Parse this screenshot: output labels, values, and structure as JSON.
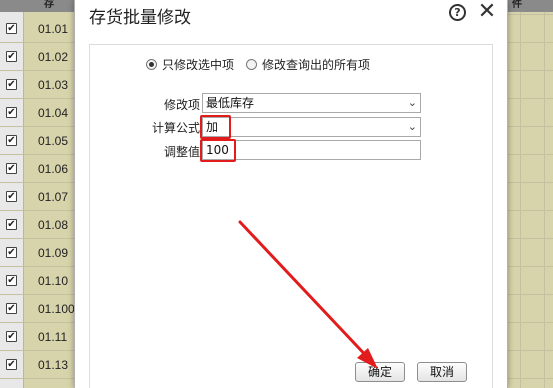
{
  "background": {
    "header_fragments": [
      "存",
      "件"
    ],
    "rows": [
      {
        "code": "01.01",
        "checked": true
      },
      {
        "code": "01.02",
        "checked": true
      },
      {
        "code": "01.03",
        "checked": true
      },
      {
        "code": "01.04",
        "checked": true
      },
      {
        "code": "01.05",
        "checked": true
      },
      {
        "code": "01.06",
        "checked": true
      },
      {
        "code": "01.07",
        "checked": true
      },
      {
        "code": "01.08",
        "checked": true
      },
      {
        "code": "01.09",
        "checked": true
      },
      {
        "code": "01.10",
        "checked": true
      },
      {
        "code": "01.100",
        "checked": true
      },
      {
        "code": "01.11",
        "checked": true
      },
      {
        "code": "01.13",
        "checked": true
      }
    ],
    "check_glyph": "✔"
  },
  "dialog": {
    "title": "存货批量修改",
    "help_glyph": "?",
    "close_glyph": "✕",
    "radios": {
      "option1": "只修改选中项",
      "option2": "修改查询出的所有项",
      "selected": "option1"
    },
    "fields": {
      "modify_item_label": "修改项",
      "modify_item_value": "最低库存",
      "formula_label": "计算公式",
      "formula_value": "加",
      "adjust_label": "调整值",
      "adjust_value": "100"
    },
    "buttons": {
      "ok": "确定",
      "cancel": "取消"
    }
  },
  "colors": {
    "annotation_red": "#e21c1c",
    "grid_bg": "#d7d3ab"
  }
}
